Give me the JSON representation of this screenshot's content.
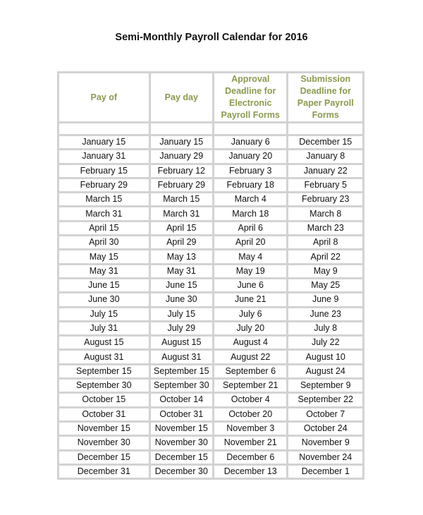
{
  "document": {
    "title": "Semi-Monthly Payroll Calendar for 2016"
  },
  "table": {
    "header_color": "#8a9a4e",
    "border_color": "#d3d3d3",
    "headers": [
      "Pay of",
      "Pay day",
      "Approval Deadline for Electronic Payroll Forms",
      "Submission Deadline for Paper Payroll Forms"
    ],
    "rows": [
      [
        "January 15",
        "January 15",
        "January 6",
        "December 15"
      ],
      [
        "January 31",
        "January 29",
        "January 20",
        "January 8"
      ],
      [
        "February 15",
        "February 12",
        "February 3",
        "January 22"
      ],
      [
        "February 29",
        "February 29",
        "February 18",
        "February 5"
      ],
      [
        "March 15",
        "March 15",
        "March 4",
        "February 23"
      ],
      [
        "March 31",
        "March 31",
        "March 18",
        "March 8"
      ],
      [
        "April 15",
        "April 15",
        "April 6",
        "March 23"
      ],
      [
        "April 30",
        "April 29",
        "April 20",
        "April 8"
      ],
      [
        "May 15",
        "May 13",
        "May 4",
        "April 22"
      ],
      [
        "May 31",
        "May 31",
        "May 19",
        "May 9"
      ],
      [
        "June 15",
        "June 15",
        "June 6",
        "May 25"
      ],
      [
        "June 30",
        "June 30",
        "June 21",
        "June 9"
      ],
      [
        "July 15",
        "July 15",
        "July 6",
        "June 23"
      ],
      [
        "July 31",
        "July 29",
        "July 20",
        "July 8"
      ],
      [
        "August 15",
        "August 15",
        "August 4",
        "July 22"
      ],
      [
        "August 31",
        "August 31",
        "August 22",
        "August 10"
      ],
      [
        "September 15",
        "September 15",
        "September 6",
        "August 24"
      ],
      [
        "September 30",
        "September 30",
        "September 21",
        "September 9"
      ],
      [
        "October 15",
        "October 14",
        "October 4",
        "September 22"
      ],
      [
        "October 31",
        "October 31",
        "October 20",
        "October 7"
      ],
      [
        "November 15",
        "November 15",
        "November 3",
        "October 24"
      ],
      [
        "November 30",
        "November 30",
        "November 21",
        "November 9"
      ],
      [
        "December 15",
        "December 15",
        "December 6",
        "November 24"
      ],
      [
        "December 31",
        "December 30",
        "December 13",
        "December 1"
      ]
    ]
  }
}
